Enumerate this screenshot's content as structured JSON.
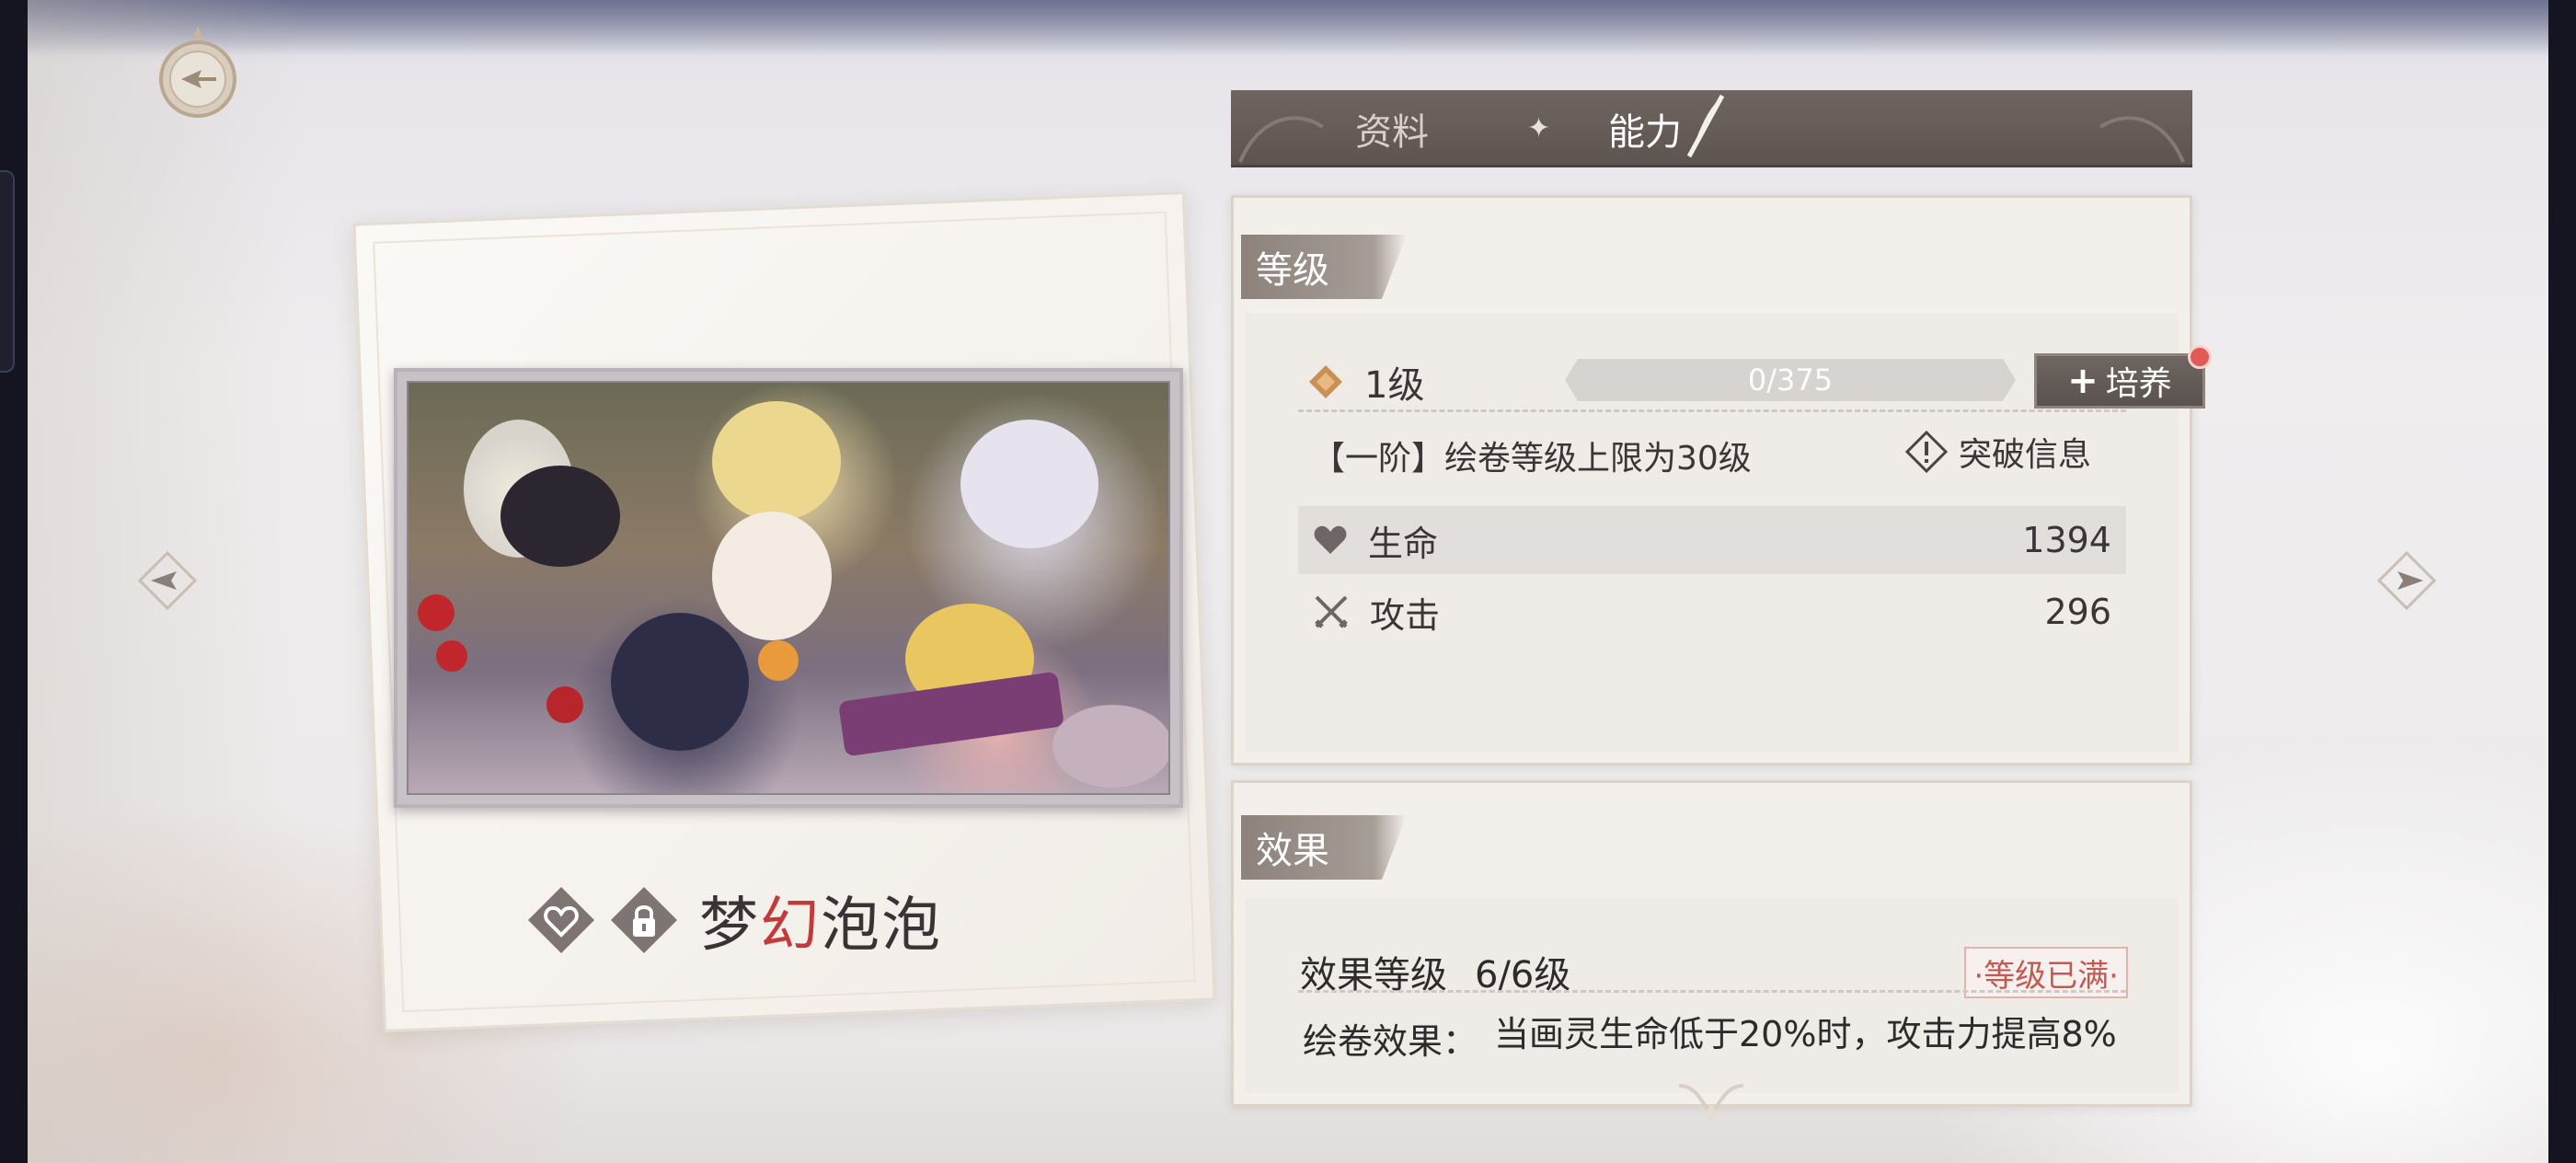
{
  "tabs": [
    {
      "label": "资料",
      "active": false
    },
    {
      "label": "能力",
      "active": true
    }
  ],
  "card": {
    "title_part1": "梦",
    "title_accent": "幻",
    "title_part2": "泡泡",
    "favorite_icon": "heart-icon",
    "lock_icon": "lock-icon"
  },
  "level_section": {
    "header": "等级",
    "level_label": "1级",
    "progress_text": "0/375",
    "progress_fraction": 0,
    "train_button": "培养",
    "rank_text": "【一阶】绘卷等级上限为30级",
    "break_info_label": "突破信息",
    "stats": [
      {
        "icon": "heart-icon",
        "name": "生命",
        "value": "1394"
      },
      {
        "icon": "crossed-swords-icon",
        "name": "攻击",
        "value": "296"
      }
    ]
  },
  "effect_section": {
    "header": "效果",
    "effect_level_label": "效果等级",
    "effect_level_value": "6/6级",
    "max_badge": "·等级已满·",
    "desc_label": "绘卷效果：",
    "desc_text": "当画灵生命低于20%时，攻击力提高8%"
  },
  "colors": {
    "accent_red": "#c23a3a",
    "tab_bar": "#5d5450",
    "notification_dot": "#e05a56"
  }
}
